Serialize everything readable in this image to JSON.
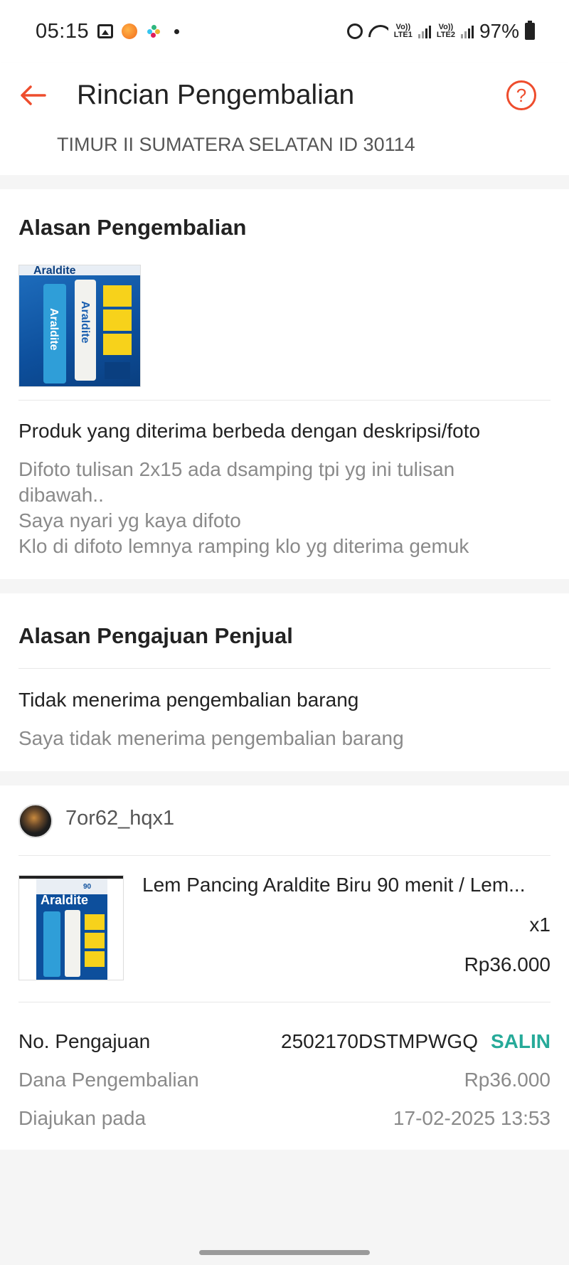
{
  "status_bar": {
    "time": "05:15",
    "lte1": "Vo))\nLTE1",
    "lte2": "Vo))\nLTE2",
    "battery": "97%"
  },
  "header": {
    "title": "Rincian Pengembalian",
    "help_symbol": "?"
  },
  "address": {
    "line": "TIMUR II SUMATERA SELATAN ID 30114"
  },
  "return_reason": {
    "title": "Alasan Pengembalian",
    "reason": "Produk yang diterima berbeda dengan deskripsi/foto",
    "detail_lines": [
      "Difoto tulisan 2x15 ada dsamping  tpi yg ini tulisan dibawah..",
      "Saya nyari yg kaya difoto",
      "Klo di difoto lemnya ramping klo yg diterima gemuk"
    ]
  },
  "seller_reason": {
    "title": "Alasan Pengajuan Penjual",
    "reason": "Tidak menerima pengembalian barang",
    "detail": "Saya tidak menerima pengembalian barang"
  },
  "order": {
    "username": "7or62_hqx1",
    "product_name": "Lem Pancing Araldite Biru 90 menit / Lem...",
    "quantity": "x1",
    "price": "Rp36.000"
  },
  "details": {
    "submission_label": "No. Pengajuan",
    "submission_value": "2502170DSTMPWGQ",
    "copy_label": "SALIN",
    "refund_label": "Dana Pengembalian",
    "refund_value": "Rp36.000",
    "submitted_label": "Diajukan pada",
    "submitted_value": "17-02-2025 13:53"
  },
  "colors": {
    "accent": "#ee4d2d",
    "copy": "#26aa99",
    "muted_text": "#8a8a8a"
  }
}
